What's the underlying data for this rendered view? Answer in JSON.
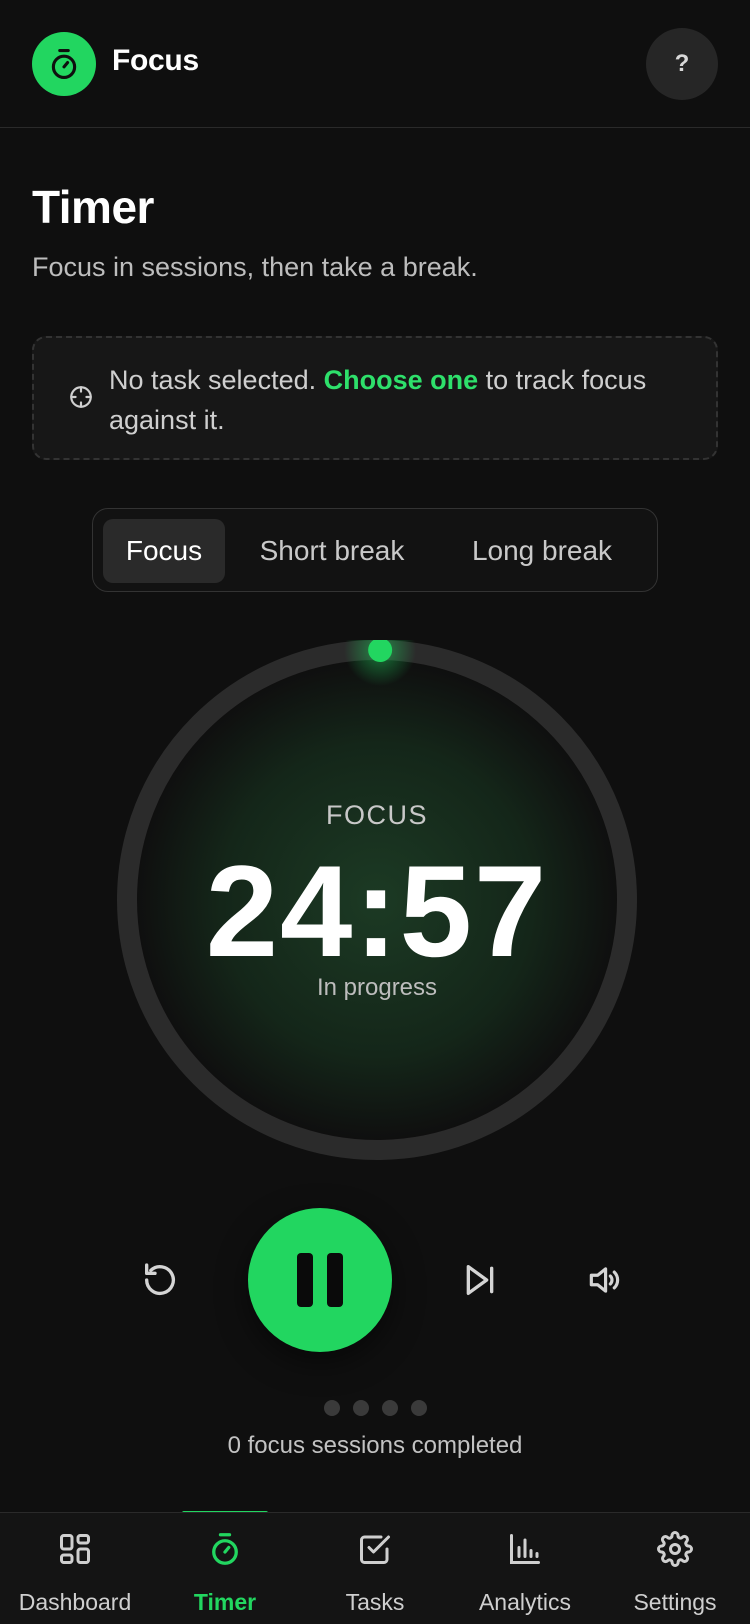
{
  "app": {
    "title": "Focus",
    "help_label": "?"
  },
  "page": {
    "title": "Timer",
    "subtitle": "Focus in sessions, then take a break."
  },
  "task_notice": {
    "prefix": "No task selected. ",
    "link": "Choose one",
    "suffix": " to track focus against it."
  },
  "modes": [
    {
      "label": "Focus",
      "active": true
    },
    {
      "label": "Short break",
      "active": false
    },
    {
      "label": "Long break",
      "active": false
    }
  ],
  "timer": {
    "mode": "FOCUS",
    "time": "24:57",
    "status": "In progress",
    "progress_fraction": 0.002
  },
  "controls": {
    "reset_icon": "reset-icon",
    "pause_icon": "pause-icon",
    "skip_icon": "skip-icon",
    "sound_icon": "volume-icon"
  },
  "sessions": {
    "count_text": "0 focus sessions completed",
    "completed": 0,
    "total": 4
  },
  "nav": [
    {
      "label": "Dashboard",
      "icon": "dashboard-icon",
      "active": false
    },
    {
      "label": "Timer",
      "icon": "timer-icon",
      "active": true
    },
    {
      "label": "Tasks",
      "icon": "tasks-icon",
      "active": false
    },
    {
      "label": "Analytics",
      "icon": "analytics-icon",
      "active": false
    },
    {
      "label": "Settings",
      "icon": "settings-icon",
      "active": false
    }
  ],
  "colors": {
    "accent": "#22d660",
    "background": "#0f0f0f",
    "surface": "#262626"
  }
}
